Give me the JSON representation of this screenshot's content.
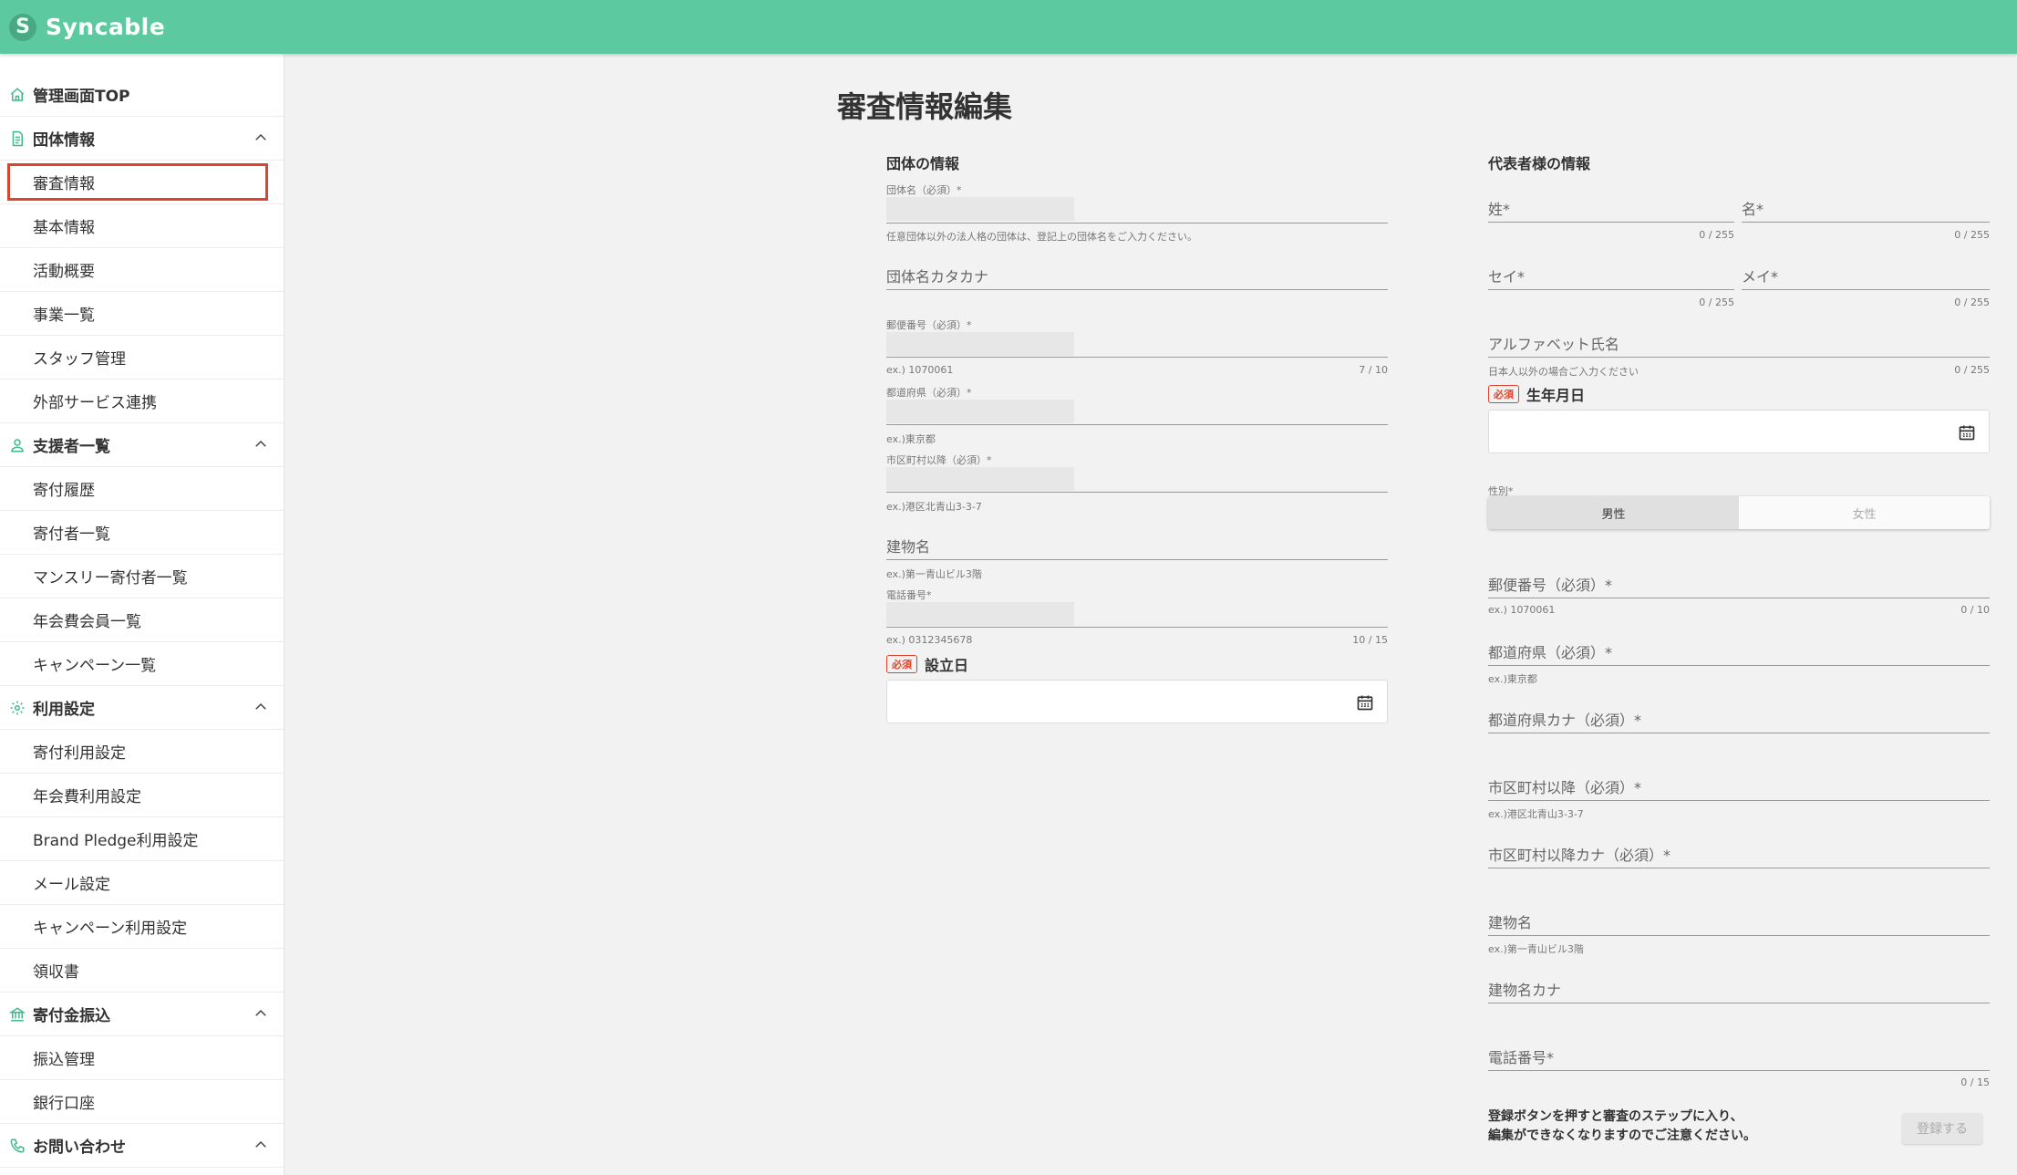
{
  "app": {
    "brand": "Syncable",
    "logo_letter": "S"
  },
  "sidebar": {
    "groups": [
      {
        "label": "管理画面TOP",
        "icon": "home-icon",
        "expandable": false,
        "items": []
      },
      {
        "label": "団体情報",
        "icon": "document-icon",
        "expandable": true,
        "items": [
          "審査情報",
          "基本情報",
          "活動概要",
          "事業一覧",
          "スタッフ管理",
          "外部サービス連携"
        ]
      },
      {
        "label": "支援者一覧",
        "icon": "user-icon",
        "expandable": true,
        "items": [
          "寄付履歴",
          "寄付者一覧",
          "マンスリー寄付者一覧",
          "年会費会員一覧",
          "キャンペーン一覧"
        ]
      },
      {
        "label": "利用設定",
        "icon": "gear-icon",
        "expandable": true,
        "items": [
          "寄付利用設定",
          "年会費利用設定",
          "Brand Pledge利用設定",
          "メール設定",
          "キャンペーン利用設定",
          "領収書"
        ]
      },
      {
        "label": "寄付金振込",
        "icon": "bank-icon",
        "expandable": true,
        "items": [
          "振込管理",
          "銀行口座"
        ]
      },
      {
        "label": "お問い合わせ",
        "icon": "phone-icon",
        "expandable": true,
        "items": []
      }
    ],
    "active_item": "審査情報"
  },
  "page": {
    "title": "審査情報編集"
  },
  "org": {
    "section_title": "団体の情報",
    "name_label": "団体名（必須）*",
    "name_helper": "任意団体以外の法人格の団体は、登記上の団体名をご入力ください。",
    "kana_label": "団体名カタカナ",
    "postal_label": "郵便番号（必須）*",
    "postal_helper": "ex.) 1070061",
    "postal_counter": "7 / 10",
    "pref_label": "都道府県（必須）*",
    "pref_helper": "ex.)東京都",
    "city_label": "市区町村以降（必須）*",
    "city_helper": "ex.)港区北青山3-3-7",
    "building_label": "建物名",
    "building_helper": "ex.)第一青山ビル3階",
    "phone_label": "電話番号*",
    "phone_helper": "ex.) 0312345678",
    "phone_counter": "10 / 15",
    "required_badge": "必須",
    "founded_label": "設立日"
  },
  "rep": {
    "section_title": "代表者様の情報",
    "last_name_label": "姓*",
    "first_name_label": "名*",
    "last_kana_label": "セイ*",
    "first_kana_label": "メイ*",
    "name_counter": "0 / 255",
    "alpha_label": "アルファベット氏名",
    "alpha_helper": "日本人以外の場合ご入力ください",
    "alpha_counter": "0 / 255",
    "required_badge": "必須",
    "birth_label": "生年月日",
    "gender_label": "性別*",
    "gender_male": "男性",
    "gender_female": "女性",
    "gender_selected": "男性",
    "postal_label": "郵便番号（必須）*",
    "postal_helper": "ex.) 1070061",
    "postal_counter": "0 / 10",
    "pref_label": "都道府県（必須）*",
    "pref_helper": "ex.)東京都",
    "pref_kana_label": "都道府県カナ（必須）*",
    "city_label": "市区町村以降（必須）*",
    "city_helper": "ex.)港区北青山3-3-7",
    "city_kana_label": "市区町村以降カナ（必須）*",
    "building_label": "建物名",
    "building_helper": "ex.)第一青山ビル3階",
    "building_kana_label": "建物名カナ",
    "phone_label": "電話番号*",
    "phone_counter": "0 / 15"
  },
  "footer": {
    "notice_line1": "登録ボタンを押すと審査のステップに入り、",
    "notice_line2": "編集ができなくなりますのでご注意ください。",
    "submit_label": "登録する"
  },
  "colors": {
    "header": "#5cc9a0",
    "icon_green": "#3fb98b",
    "required_red": "#e0432b",
    "highlight": "#e0432b"
  }
}
